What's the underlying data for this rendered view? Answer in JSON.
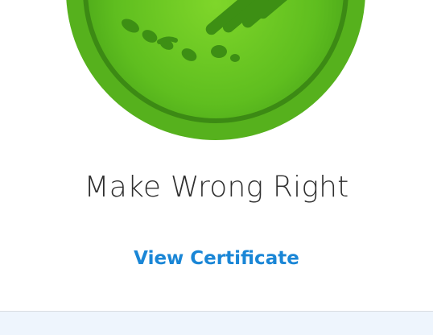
{
  "badge": {
    "icon": "handshake-icon",
    "colors": {
      "outer": "#4fa81c",
      "inner": "#6cc521",
      "ring": "#3c8a14",
      "shadow": "#2f7410"
    }
  },
  "achievement": {
    "title": "Make Wrong Right",
    "link_label": "View Certificate",
    "link_color": "#1a86d6"
  }
}
